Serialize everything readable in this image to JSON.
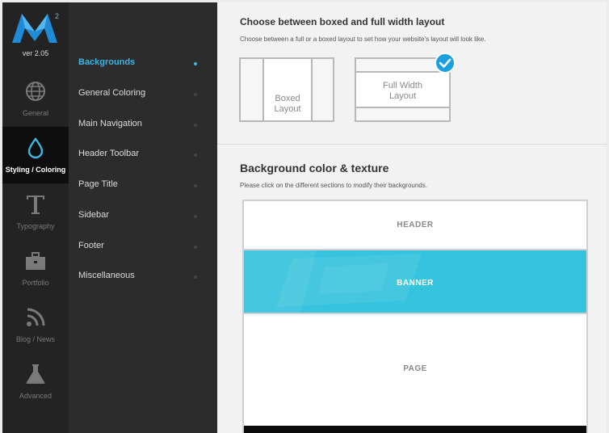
{
  "logo": {
    "superscript": "2",
    "version": "ver 2.05"
  },
  "rail": [
    {
      "label": "General",
      "icon": "globe-icon"
    },
    {
      "label": "Styling / Coloring",
      "icon": "drop-icon"
    },
    {
      "label": "Typography",
      "icon": "typography-icon"
    },
    {
      "label": "Portfolio",
      "icon": "briefcase-icon"
    },
    {
      "label": "Blog / News",
      "icon": "feed-icon"
    },
    {
      "label": "Advanced",
      "icon": "flask-icon"
    }
  ],
  "submenu": [
    {
      "label": "Backgrounds"
    },
    {
      "label": "General Coloring"
    },
    {
      "label": "Main Navigation"
    },
    {
      "label": "Header Toolbar"
    },
    {
      "label": "Page Title"
    },
    {
      "label": "Sidebar"
    },
    {
      "label": "Footer"
    },
    {
      "label": "Miscellaneous"
    }
  ],
  "layout_section": {
    "title": "Choose between boxed and full width layout",
    "description": "Choose between a full or a boxed layout to set how your website's layout will look like.",
    "boxed_line1": "Boxed",
    "boxed_line2": "Layout",
    "full_line1": "Full Width",
    "full_line2": "Layout"
  },
  "background_section": {
    "title": "Background color & texture",
    "description": "Please click on the different sections to modify their backgrounds.",
    "header": "HEADER",
    "banner": "BANNER",
    "page": "PAGE"
  },
  "colors": {
    "accent": "#3cb6e3",
    "banner": "#36c3dd",
    "check": "#1a9fe0"
  }
}
